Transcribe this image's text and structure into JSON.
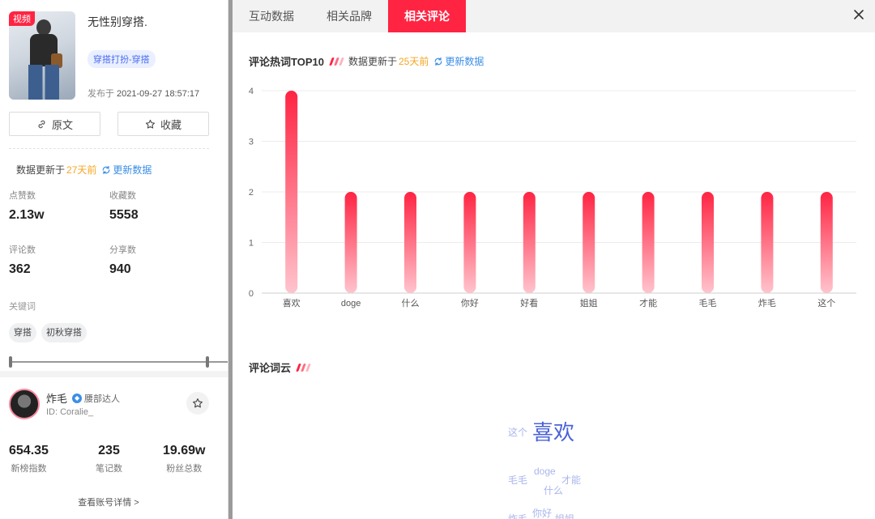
{
  "post": {
    "video_badge": "视频",
    "title": "无性别穿搭.",
    "tag": "穿搭打扮-穿搭",
    "publish_label": "发布于",
    "publish_time": "2021-09-27 18:57:17",
    "btn_origin": "原文",
    "btn_fav": "收藏"
  },
  "left_update": {
    "prefix": "数据更新于",
    "days": "27天前",
    "refresh": "更新数据"
  },
  "stats": [
    {
      "label": "点赞数",
      "value": "2.13w"
    },
    {
      "label": "收藏数",
      "value": "5558"
    },
    {
      "label": "评论数",
      "value": "362"
    },
    {
      "label": "分享数",
      "value": "940"
    }
  ],
  "keywords": {
    "label": "关键词",
    "items": [
      "穿搭",
      "初秋穿搭"
    ]
  },
  "account": {
    "name": "炸毛",
    "badge": "腰部达人",
    "id": "ID: Coralie_",
    "metrics": [
      {
        "value": "654.35",
        "label": "新榜指数"
      },
      {
        "value": "235",
        "label": "笔记数"
      },
      {
        "value": "19.69w",
        "label": "粉丝总数"
      }
    ],
    "detail_link": "查看账号详情 >"
  },
  "tabs": [
    {
      "label": "互动数据",
      "active": false
    },
    {
      "label": "相关品牌",
      "active": false
    },
    {
      "label": "相关评论",
      "active": true
    }
  ],
  "top10": {
    "title": "评论热词TOP10",
    "update_prefix": "数据更新于",
    "update_days": "25天前",
    "refresh": "更新数据"
  },
  "chart_data": {
    "type": "bar",
    "categories": [
      "喜欢",
      "doge",
      "什么",
      "你好",
      "好看",
      "姐姐",
      "才能",
      "毛毛",
      "炸毛",
      "这个"
    ],
    "values": [
      4,
      2,
      2,
      2,
      2,
      2,
      2,
      2,
      2,
      2
    ],
    "title": "",
    "xlabel": "",
    "ylabel": "",
    "ylim": [
      0,
      4
    ],
    "yticks": [
      0,
      1,
      2,
      3,
      4
    ],
    "grid": true,
    "legend": "none",
    "bar_color_top": "#ff2442",
    "bar_color_bottom": "#ffc4cd"
  },
  "cloud": {
    "title": "评论词云",
    "words": [
      {
        "text": "这个",
        "weight": 2
      },
      {
        "text": "喜欢",
        "weight": 4
      },
      {
        "text": "毛毛",
        "weight": 2
      },
      {
        "text": "doge",
        "weight": 2
      },
      {
        "text": "才能",
        "weight": 2
      },
      {
        "text": "什么",
        "weight": 2
      },
      {
        "text": "炸毛",
        "weight": 2
      },
      {
        "text": "你好",
        "weight": 2
      },
      {
        "text": "姐姐",
        "weight": 2
      }
    ]
  },
  "colors": {
    "accent": "#ff2442",
    "link": "#3a8ee6",
    "days": "#f5a623"
  }
}
